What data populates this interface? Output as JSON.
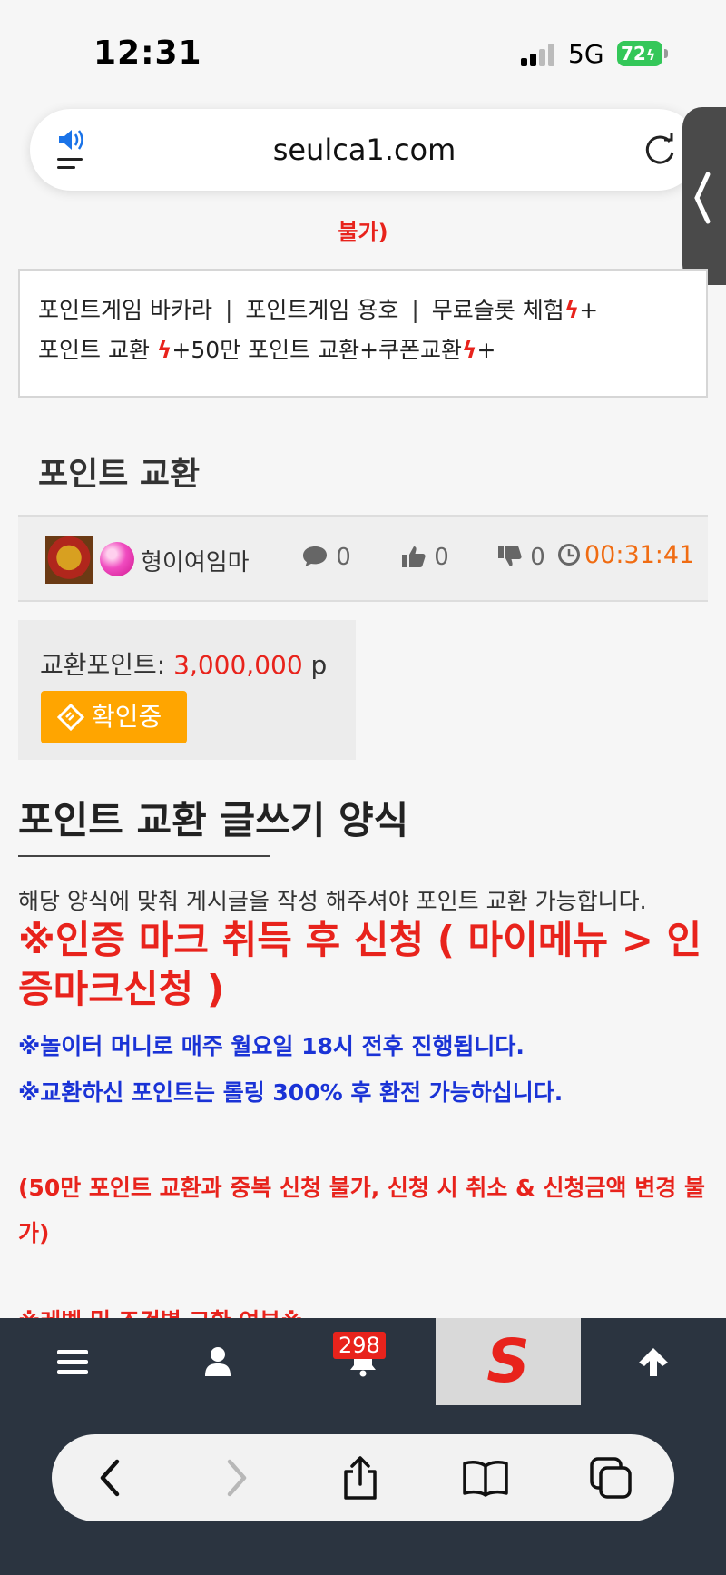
{
  "status_bar": {
    "time": "12:31",
    "network": "5G",
    "battery": "72"
  },
  "browser": {
    "url": "seulca1.com"
  },
  "content": {
    "top_red_text": "불가)",
    "nav_links": {
      "item1": "포인트게임 바카라",
      "item2": "포인트게임 용호",
      "item3": "무료슬롯 체험",
      "item4": "포인트 교환",
      "item5": "50만 포인트 교환",
      "item6": "쿠폰교환",
      "separator": "|",
      "bolt": "ϟ",
      "plus": "+"
    },
    "section_title": "포인트 교환",
    "post_meta": {
      "nickname": "형이여임마",
      "comments": "0",
      "likes": "0",
      "dislikes": "0",
      "time": "00:31:41"
    },
    "exchange": {
      "label": "교환포인트: ",
      "amount": "3,000,000",
      "unit": " p",
      "status_button": "확인중"
    },
    "form": {
      "title": "포인트 교환 글쓰기 양식",
      "description": "해당 양식에 맞춰 게시글을 작성 해주셔야 포인트 교환 가능합니다.",
      "notice_red_big": "※인증 마크 취득 후 신청 ( 마이메뉴 > 인증마크신청 )",
      "notice_blue_1": "※놀이터 머니로 매주 월요일 18시 전후 진행됩니다.",
      "notice_blue_2": "※교환하신 포인트는 롤링 300% 후 환전 가능하십니다.",
      "notice_red_small": "(50만 포인트 교환과 중복 신청 불가, 신청 시 취소 & 신청금액 변경 불가)",
      "notice_cut": "※레벨 및 조건별 교환 여부※"
    }
  },
  "site_nav": {
    "notification_count": "298",
    "logo": "S"
  },
  "colors": {
    "accent_red": "#e8231c",
    "accent_blue": "#1a33d6",
    "status_orange": "#ffa500",
    "nav_dark": "#2b3440"
  }
}
